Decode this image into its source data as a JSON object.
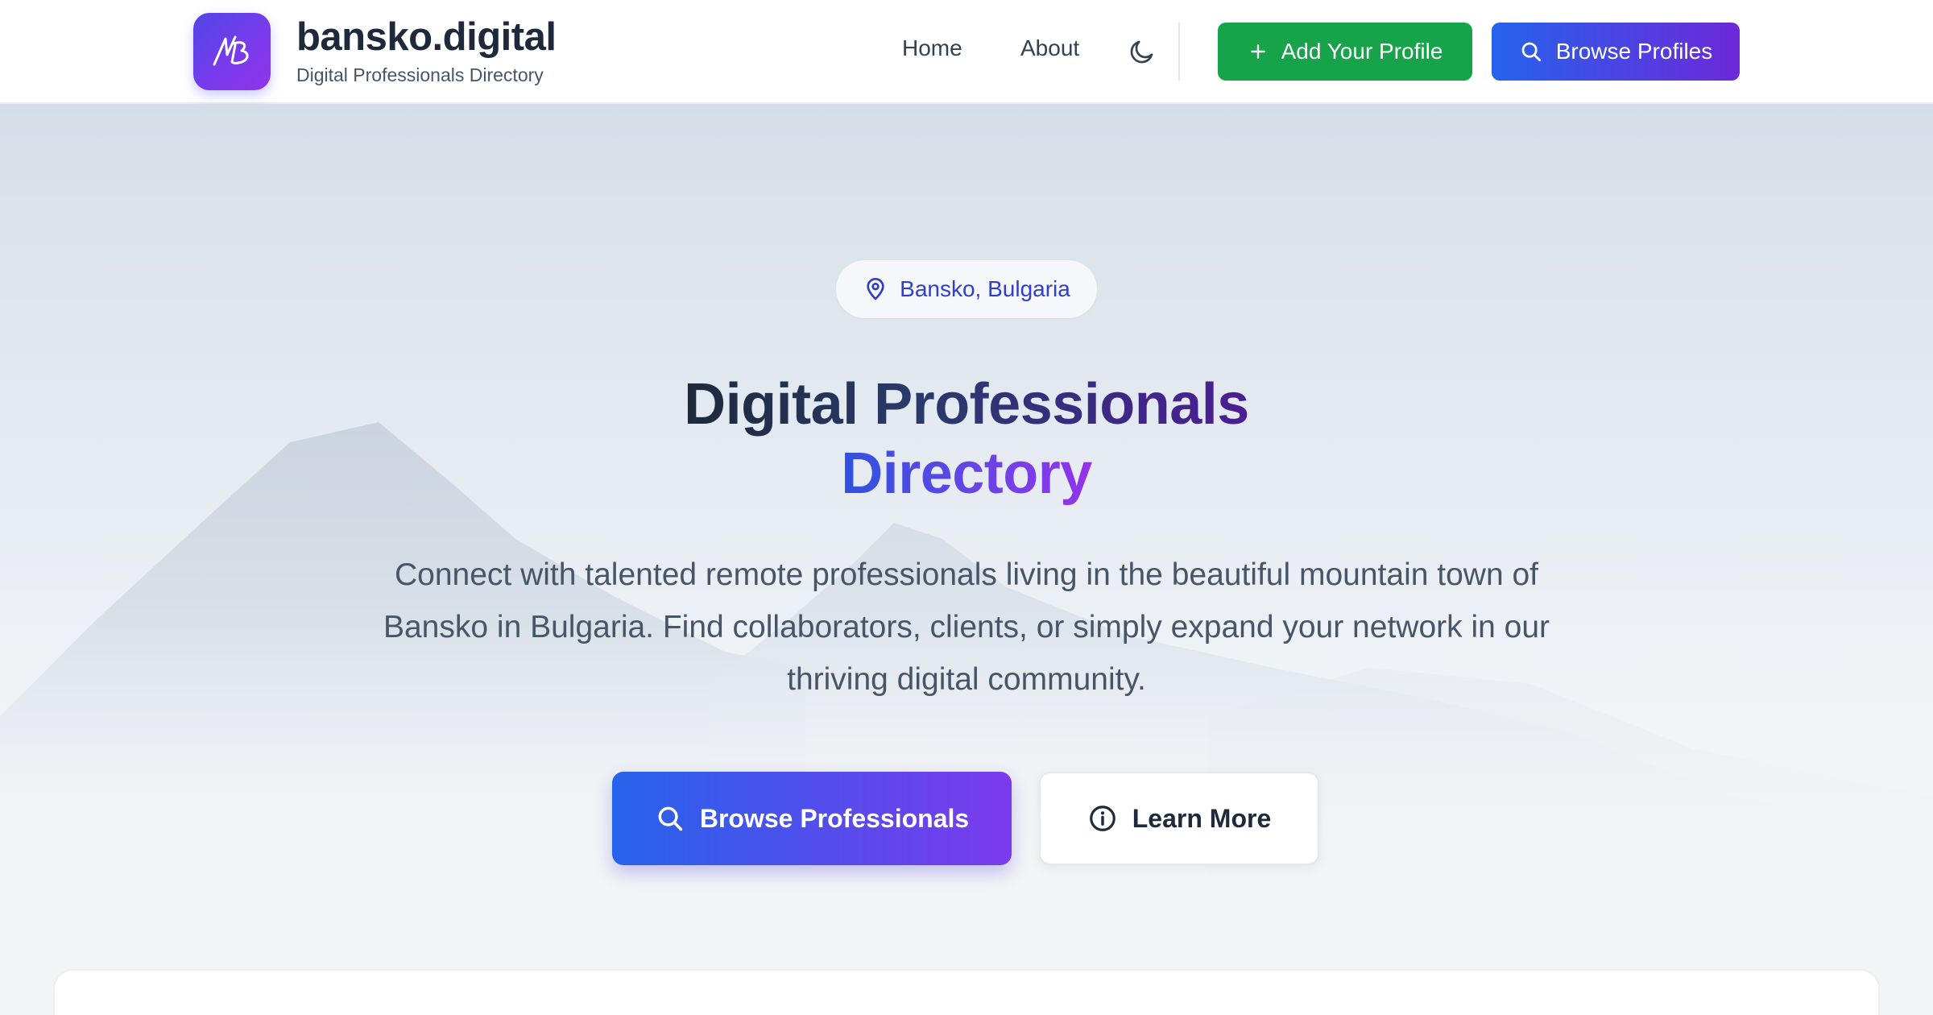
{
  "header": {
    "brand_title": "bansko.digital",
    "brand_subtitle": "Digital Professionals Directory",
    "nav": {
      "home": "Home",
      "about": "About"
    },
    "add_profile_label": "Add Your Profile",
    "browse_profiles_label": "Browse Profiles"
  },
  "hero": {
    "location": "Bansko, Bulgaria",
    "title_line1": "Digital Professionals",
    "title_line2": "Directory",
    "description": "Connect with talented remote professionals living in the beautiful mountain town of Bansko in Bulgaria. Find collaborators, clients, or simply expand your network in our thriving digital community.",
    "browse_button": "Browse Professionals",
    "learn_button": "Learn More"
  },
  "colors": {
    "brand_gradient_start": "#4f46e5",
    "brand_gradient_end": "#9333ea",
    "add_button": "#16a34a",
    "browse_gradient_start": "#2563eb",
    "browse_gradient_end": "#7c3aed",
    "location_text": "#2f3fc9"
  },
  "icons": {
    "logo": "bansko-logo-icon",
    "theme": "moon-icon",
    "add": "plus-icon",
    "search": "search-icon",
    "location": "map-pin-icon",
    "info": "info-icon"
  }
}
